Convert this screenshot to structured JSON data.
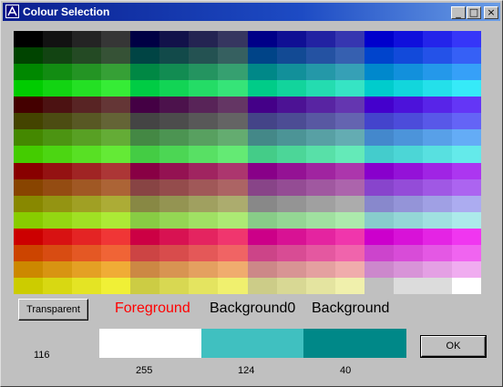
{
  "window": {
    "title": "Colour Selection",
    "buttons": {
      "minimize": "_",
      "maximize": "□",
      "close": "×"
    }
  },
  "palette": {
    "columns": 16,
    "rows": 16,
    "colors": [
      "#000000",
      "#121212",
      "#242424",
      "#363636",
      "#000044",
      "#12124a",
      "#242452",
      "#363660",
      "#000088",
      "#101094",
      "#2222a2",
      "#3636b0",
      "#0000cc",
      "#1010dc",
      "#2424ea",
      "#3636f8",
      "#004400",
      "#124412",
      "#244a24",
      "#365236",
      "#004444",
      "#124a4a",
      "#245252",
      "#366060",
      "#004488",
      "#124a94",
      "#2452a2",
      "#3660b0",
      "#0044cc",
      "#124ada",
      "#2452e8",
      "#3660f6",
      "#008800",
      "#128c12",
      "#249424",
      "#36a036",
      "#008844",
      "#128c52",
      "#249460",
      "#36a070",
      "#008888",
      "#12909a",
      "#2498a8",
      "#36a0b6",
      "#0088cc",
      "#1290dc",
      "#2498ea",
      "#36a0f8",
      "#00cc00",
      "#12d412",
      "#24e024",
      "#36ec36",
      "#00cc44",
      "#12d455",
      "#24dc66",
      "#36e478",
      "#00cc88",
      "#12d49c",
      "#24dcb0",
      "#36e4c4",
      "#00cccc",
      "#12d6dc",
      "#24e0ea",
      "#36eaf8",
      "#440000",
      "#4c1212",
      "#582424",
      "#643636",
      "#440044",
      "#4c124c",
      "#582458",
      "#643664",
      "#440088",
      "#4c1294",
      "#5824a2",
      "#6436b0",
      "#4400cc",
      "#4c12da",
      "#5824e8",
      "#6436f6",
      "#444400",
      "#4c4c12",
      "#585824",
      "#646436",
      "#444444",
      "#4c4c4c",
      "#585858",
      "#646464",
      "#444488",
      "#4c4c94",
      "#5858a2",
      "#6464b0",
      "#4444cc",
      "#4c4cda",
      "#5858e8",
      "#6464f6",
      "#448800",
      "#4c9412",
      "#58a024",
      "#64ac36",
      "#448844",
      "#4c9452",
      "#58a060",
      "#64ac70",
      "#448888",
      "#4c9496",
      "#58a0a4",
      "#64acb2",
      "#4488cc",
      "#4c94da",
      "#58a0e8",
      "#64acf6",
      "#44cc00",
      "#4cd612",
      "#58e024",
      "#64ea36",
      "#44cc44",
      "#4cd654",
      "#58e064",
      "#64ea74",
      "#44cc88",
      "#4cd698",
      "#58e0a8",
      "#64eab8",
      "#44cccc",
      "#4cd6d6",
      "#58e0e0",
      "#64eaea",
      "#880000",
      "#941212",
      "#a02424",
      "#ac3636",
      "#880044",
      "#941252",
      "#a02460",
      "#ac366e",
      "#880088",
      "#941294",
      "#a024a0",
      "#ac36ac",
      "#8800cc",
      "#9412d8",
      "#a024e4",
      "#ac36f0",
      "#884400",
      "#944c12",
      "#a05824",
      "#ac6436",
      "#884444",
      "#944c4c",
      "#a05858",
      "#ac6464",
      "#884488",
      "#944c94",
      "#a058a0",
      "#ac64ac",
      "#8844cc",
      "#944cd8",
      "#a058e4",
      "#ac64f0",
      "#888800",
      "#949412",
      "#a0a024",
      "#acac36",
      "#888844",
      "#949452",
      "#a0a060",
      "#acac6e",
      "#888888",
      "#949494",
      "#a0a0a0",
      "#acacac",
      "#8888cc",
      "#9494d8",
      "#a0a0e4",
      "#acacf0",
      "#88cc00",
      "#94d612",
      "#a0e024",
      "#acea36",
      "#88cc44",
      "#94d654",
      "#a0e064",
      "#acea74",
      "#88cc88",
      "#94d694",
      "#a0e0a0",
      "#aceaac",
      "#88cccc",
      "#94d6d6",
      "#a0e0e0",
      "#aceaea",
      "#cc0000",
      "#d81212",
      "#e42424",
      "#f03636",
      "#cc0044",
      "#d81252",
      "#e42460",
      "#f0366e",
      "#cc0088",
      "#d81294",
      "#e424a0",
      "#f036ac",
      "#cc00cc",
      "#d812d8",
      "#e424e4",
      "#f036f0",
      "#cc4400",
      "#d84c12",
      "#e45824",
      "#f06436",
      "#cc4444",
      "#d84c4c",
      "#e45858",
      "#f06464",
      "#cc4488",
      "#d84c94",
      "#e458a0",
      "#f064ac",
      "#cc44cc",
      "#d84cd8",
      "#e458e4",
      "#f064f0",
      "#cc8800",
      "#d89412",
      "#e4a024",
      "#f0ac36",
      "#cc8844",
      "#d89452",
      "#e4a060",
      "#f0ac6e",
      "#cc8888",
      "#d89494",
      "#e4a0a0",
      "#f0acac",
      "#cc88cc",
      "#d894d8",
      "#e4a0e4",
      "#f0acf0",
      "#cccc00",
      "#d8d812",
      "#e4e424",
      "#f0f036",
      "#cccc44",
      "#d8d852",
      "#e4e460",
      "#f0f06e",
      "#cccc88",
      "#d8d894",
      "#e4e4a0",
      "#f0f0ac",
      "#c0c0c0",
      "#dcdcdc",
      "#dcdcdc",
      "#ffffff"
    ]
  },
  "controls": {
    "transparent_button": "Transparent",
    "ok_button": "OK",
    "foreground_label": "Foreground",
    "background0_label": "Background0",
    "background_label": "Background"
  },
  "swatches": {
    "left_value": "116",
    "foreground": {
      "color": "#ffffff",
      "value": "255"
    },
    "background0": {
      "color": "#40c0c0",
      "value": "124"
    },
    "background": {
      "color": "#008888",
      "value": "40"
    }
  },
  "colors": {
    "foreground_label": "#ff0000",
    "title_gradient_start": "#0a1f8f",
    "title_gradient_end": "#6a9de6"
  }
}
